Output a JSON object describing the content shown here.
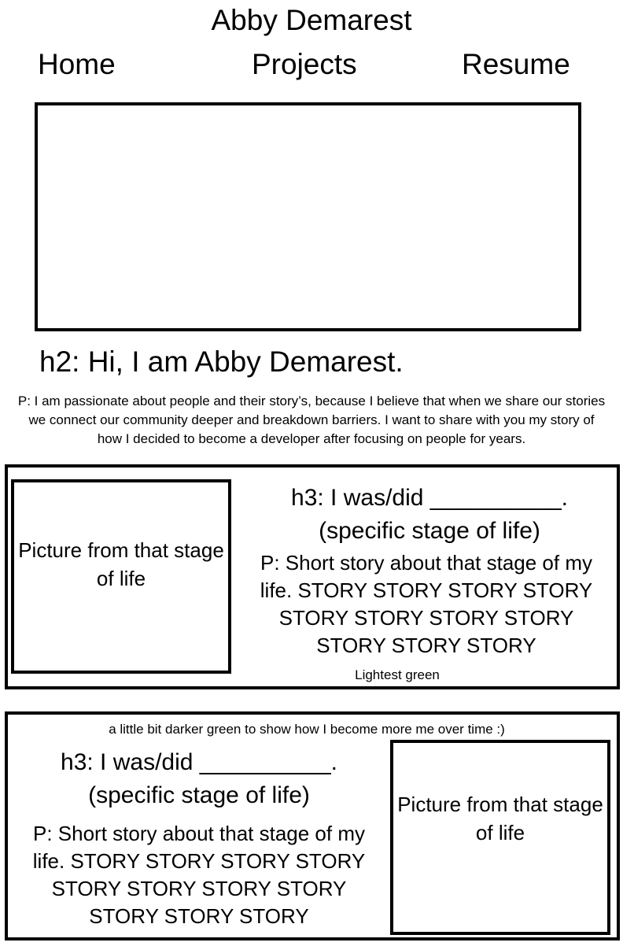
{
  "site": {
    "title": "Abby Demarest"
  },
  "nav": {
    "home": "Home",
    "projects": "Projects",
    "resume": "Resume"
  },
  "intro": {
    "heading": "h2: Hi, I am Abby Demarest.",
    "paragraph": "P: I am passionate about people and their story’s, because I believe that when we share our stories we connect our community deeper and breakdown barriers. I want to share with you my story of how I decided to become a developer after focusing on people for years."
  },
  "sections": [
    {
      "heading": "h3: I was/did __________. (specific stage of life)",
      "paragraph": "P: Short story about that stage of my life. STORY STORY STORY STORY STORY STORY STORY STORY STORY STORY STORY",
      "picture_label": "Picture from that stage of life",
      "note": "Lightest green"
    },
    {
      "heading": "h3: I was/did __________. (specific stage of life)",
      "paragraph": "P: Short story about that stage of my life. STORY STORY STORY STORY STORY STORY STORY STORY STORY STORY STORY",
      "picture_label": "Picture from that stage of life",
      "note": "a little bit darker green to show how I become more me over time :)"
    }
  ]
}
